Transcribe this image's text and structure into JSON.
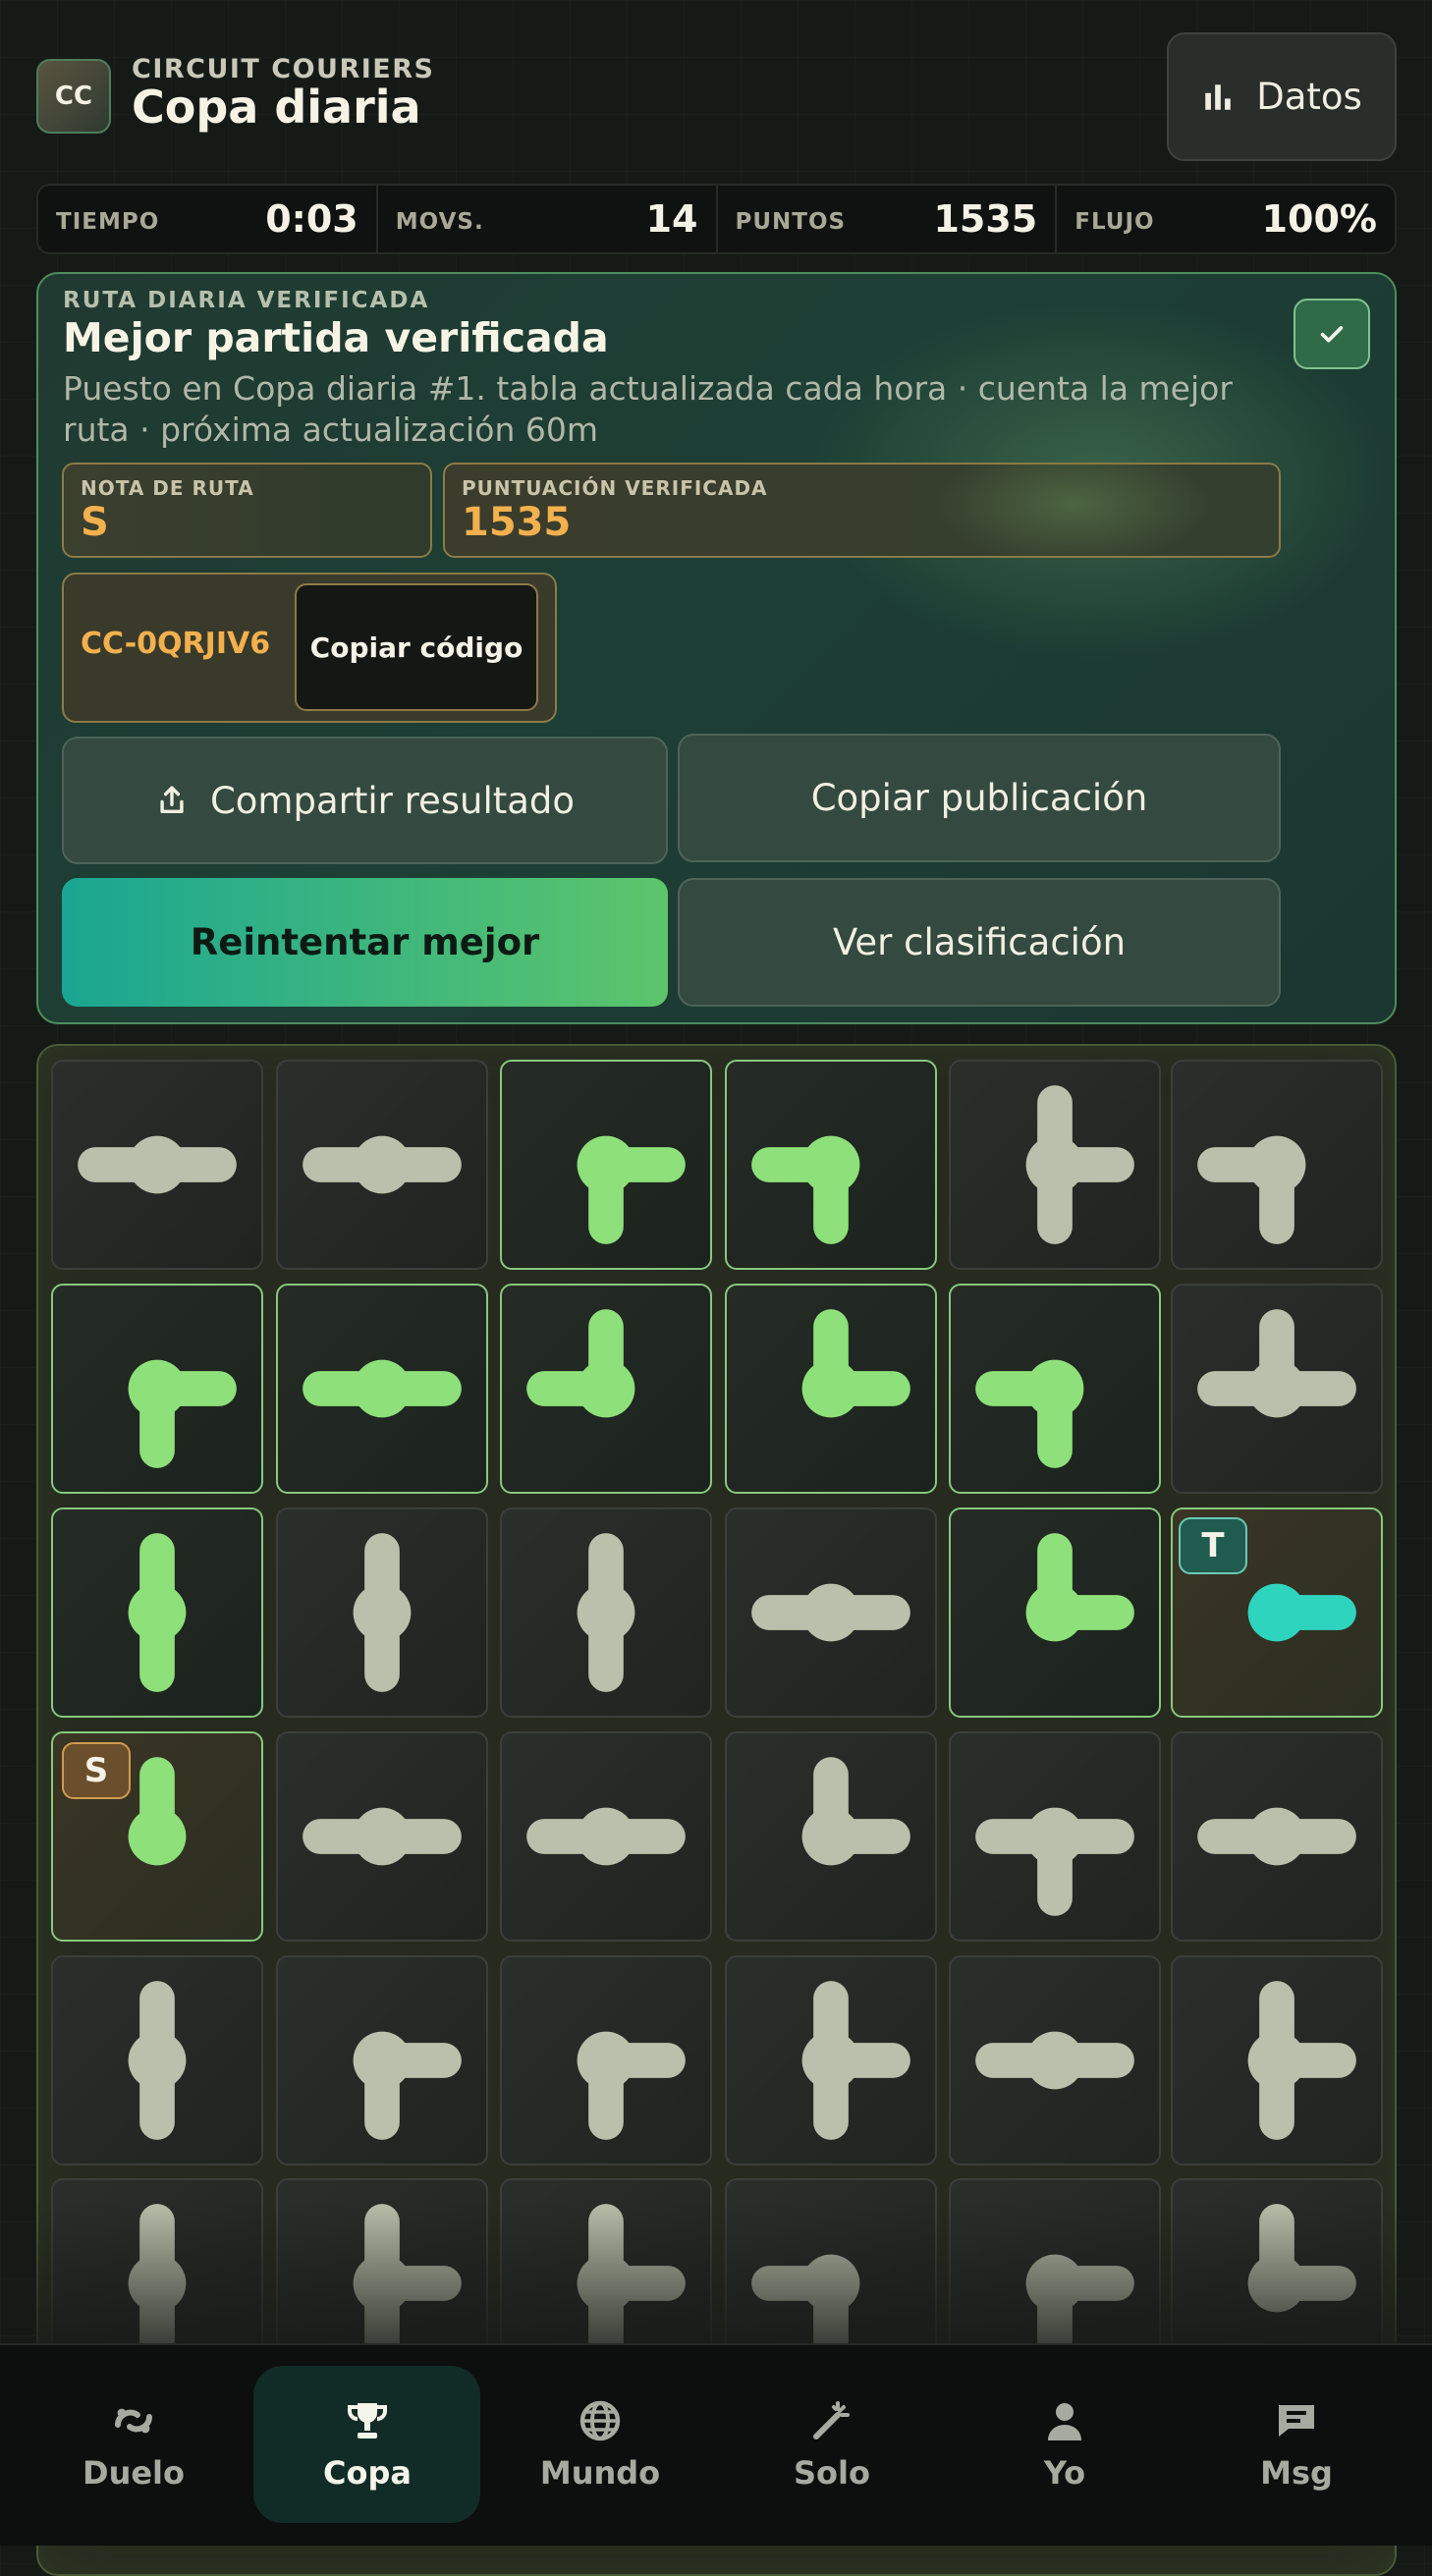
{
  "header": {
    "logo": "CC",
    "brand": "CIRCUIT COURIERS",
    "title": "Copa diaria",
    "datos_label": "Datos",
    "datos_icon": "bar-chart-icon"
  },
  "stats": [
    {
      "label": "TIEMPO",
      "value": "0:03"
    },
    {
      "label": "MOVS.",
      "value": "14"
    },
    {
      "label": "PUNTOS",
      "value": "1535"
    },
    {
      "label": "FLUJO",
      "value": "100%"
    }
  ],
  "result": {
    "eyebrow": "RUTA DIARIA VERIFICADA",
    "title": "Mejor partida verificada",
    "description": "Puesto en Copa diaria #1. tabla actualizada cada hora · cuenta la mejor ruta · próxima actualización 60m",
    "grade_label": "NOTA DE RUTA",
    "grade_value": "S",
    "score_label": "PUNTUACIÓN VERIFICADA",
    "score_value": "1535",
    "code": "CC-0QRJIV6",
    "copy_code_label": "Copiar código",
    "share_label": "Compartir resultado",
    "copy_post_label": "Copiar publicación",
    "retry_label": "Reintentar mejor",
    "ranking_label": "Ver clasificación"
  },
  "board": {
    "source_badge": "S",
    "target_badge": "T",
    "colors": {
      "inactive": "#b9c0ab",
      "powered": "#8ee07a",
      "target": "#2fd4bf"
    },
    "tiles": [
      [
        {
          "c": "ELW",
          "s": ""
        },
        {
          "c": "ELW",
          "s": ""
        },
        {
          "c": "ES",
          "s": "on"
        },
        {
          "c": "SW",
          "s": "on"
        },
        {
          "c": "NES",
          "s": ""
        },
        {
          "c": "SW",
          "s": ""
        }
      ],
      [
        {
          "c": "ES",
          "s": "on"
        },
        {
          "c": "EW",
          "s": "on"
        },
        {
          "c": "NW",
          "s": "on"
        },
        {
          "c": "NE",
          "s": "on"
        },
        {
          "c": "SW",
          "s": "on"
        },
        {
          "c": "NEW",
          "s": ""
        }
      ],
      [
        {
          "c": "NS",
          "s": "on"
        },
        {
          "c": "NS",
          "s": ""
        },
        {
          "c": "NS",
          "s": ""
        },
        {
          "c": "EW",
          "s": ""
        },
        {
          "c": "NE",
          "s": "on"
        },
        {
          "c": "E",
          "s": "tgt"
        }
      ],
      [
        {
          "c": "N",
          "s": "src"
        },
        {
          "c": "EW",
          "s": ""
        },
        {
          "c": "EW",
          "s": ""
        },
        {
          "c": "NE",
          "s": ""
        },
        {
          "c": "ESW",
          "s": ""
        },
        {
          "c": "EW",
          "s": ""
        }
      ],
      [
        {
          "c": "NS",
          "s": ""
        },
        {
          "c": "ES",
          "s": ""
        },
        {
          "c": "ES",
          "s": ""
        },
        {
          "c": "NES",
          "s": ""
        },
        {
          "c": "EW",
          "s": ""
        },
        {
          "c": "NES",
          "s": ""
        }
      ],
      [
        {
          "c": "NS",
          "s": ""
        },
        {
          "c": "NES",
          "s": ""
        },
        {
          "c": "NES",
          "s": ""
        },
        {
          "c": "SW",
          "s": ""
        },
        {
          "c": "ES",
          "s": ""
        },
        {
          "c": "NE",
          "s": ""
        }
      ]
    ]
  },
  "nav": [
    {
      "label": "Duelo",
      "icon": "duel-icon",
      "active": false
    },
    {
      "label": "Copa",
      "icon": "trophy-icon",
      "active": true
    },
    {
      "label": "Mundo",
      "icon": "globe-icon",
      "active": false
    },
    {
      "label": "Solo",
      "icon": "magic-wand-icon",
      "active": false
    },
    {
      "label": "Yo",
      "icon": "user-icon",
      "active": false
    },
    {
      "label": "Msg",
      "icon": "chat-icon",
      "active": false
    }
  ]
}
